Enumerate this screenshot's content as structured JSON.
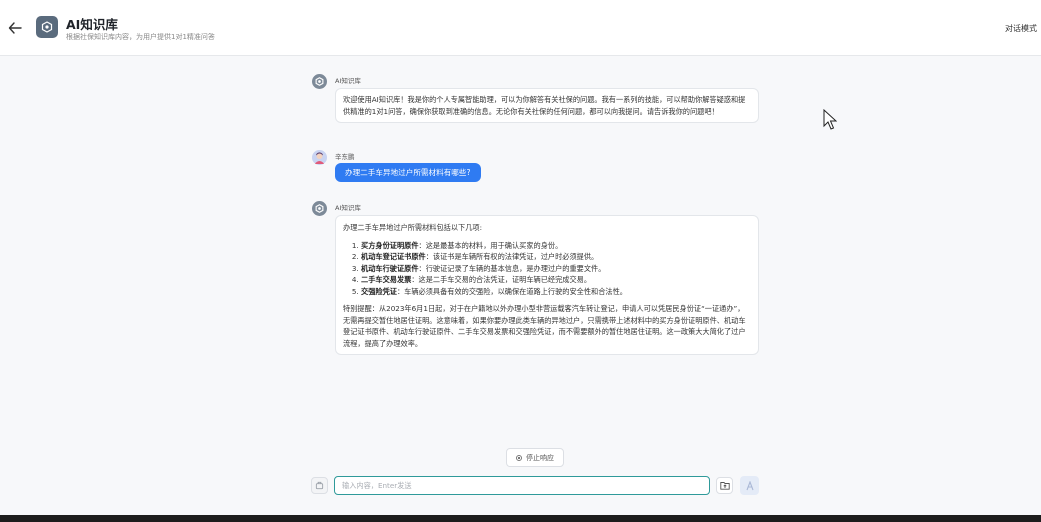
{
  "header": {
    "back_icon": "arrow-left-icon",
    "logo_icon": "hexagon-icon",
    "title": "AI知识库",
    "subtitle": "根据社保知识库内容，为用户提供1对1精准问答",
    "mode_button": "对话模式"
  },
  "messages": [
    {
      "sender": "AI知识库",
      "text": "欢迎使用AI知识库！我是你的个人专属智能助理，可以为你解答有关社保的问题。我有一系列的技能，可以帮助你解答疑惑和提供精准的1对1问答，确保你获取到准确的信息。无论你有关社保的任何问题，都可以向我提问。请告诉我你的问题吧！"
    },
    {
      "sender": "辛东鹏",
      "text": "办理二手车异地过户所需材料有哪些?"
    },
    {
      "sender": "AI知识库",
      "intro": "办理二手车异地过户所需材料包括以下几项:",
      "items": [
        {
          "term": "买方身份证明原件",
          "desc": "：这是最基本的材料，用于确认买家的身份。"
        },
        {
          "term": "机动车登记证书原件",
          "desc": "：该证书是车辆所有权的法律凭证，过户时必须提供。"
        },
        {
          "term": "机动车行驶证原件",
          "desc": "：行驶证记录了车辆的基本信息，是办理过户的重要文件。"
        },
        {
          "term": "二手车交易发票",
          "desc": "：这是二手车交易的合法凭证，证明车辆已经完成交易。"
        },
        {
          "term": "交强险凭证",
          "desc": "：车辆必须具备有效的交强险，以确保在道路上行驶的安全性和合法性。"
        }
      ],
      "note": "特别提醒：从2023年6月1日起，对于在户籍地以外办理小型非营运载客汽车转让登记，申请人可以凭居民身份证“一证通办”，无需再提交暂住地居住证明。这意味着，如果你要办理此类车辆的异地过户，只需携带上述材料中的买方身份证明原件、机动车登记证书原件、机动车行驶证原件、二手车交易发票和交强险凭证，而不需要额外的暂住地居住证明。这一政策大大简化了过户流程，提高了办理效率。"
    }
  ],
  "stop_button": "停止响应",
  "input": {
    "placeholder": "输入内容，Enter发送",
    "value": ""
  },
  "colors": {
    "accent": "#2f7bf2",
    "input_border": "#2f9a9a",
    "avatar": "#7d8a98"
  }
}
